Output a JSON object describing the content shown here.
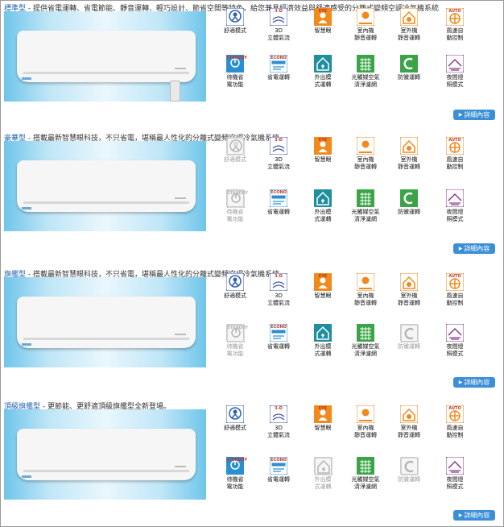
{
  "sections": [
    {
      "series": "標準型",
      "description": " - 提供省電運轉、省電節能、靜音運轉、輕巧設計、節省空間等特色，給您兼具經濟效益與舒適感受的分離式變頻空調冷氣機系統",
      "more_label": "詳細內容",
      "features": [
        {
          "label": "舒適模式",
          "icon": "comfort-icon",
          "enabled": true
        },
        {
          "label": "3D\n立體氣流",
          "icon": "3d-airflow-icon",
          "enabled": true
        },
        {
          "label": "智慧眼",
          "icon": "intelligent-eye-icon",
          "enabled": true
        },
        {
          "label": "室內機\n靜音運轉",
          "icon": "indoor-quiet-icon",
          "enabled": true
        },
        {
          "label": "室外機\n靜音運轉",
          "icon": "outdoor-quiet-icon",
          "enabled": true
        },
        {
          "label": "風速自\n動控制",
          "icon": "auto-fan-icon",
          "enabled": true
        },
        {
          "label": "待機省\n電功能",
          "icon": "standby-icon",
          "enabled": true
        },
        {
          "label": "省電運轉",
          "icon": "econo-icon",
          "enabled": true
        },
        {
          "label": "外出模\n式運轉",
          "icon": "away-mode-icon",
          "enabled": true
        },
        {
          "label": "光觸媒空氣\n清淨濾網",
          "icon": "photocatalytic-filter-icon",
          "enabled": true
        },
        {
          "label": "防黴運轉",
          "icon": "anti-mold-icon",
          "enabled": true
        },
        {
          "label": "夜間燈\n照模式",
          "icon": "night-mode-icon",
          "enabled": true
        }
      ]
    },
    {
      "series": "豪華型",
      "description": " - 搭載最新智慧眼科技，不只省電，堪稱最人性化的分離式變頻空調冷氣機系統",
      "more_label": "詳細內容",
      "features": [
        {
          "label": "舒適模式",
          "icon": "comfort-icon",
          "enabled": false
        },
        {
          "label": "3D\n立體氣流",
          "icon": "3d-airflow-icon",
          "enabled": true
        },
        {
          "label": "智慧眼",
          "icon": "intelligent-eye-icon",
          "enabled": true
        },
        {
          "label": "室內機\n靜音運轉",
          "icon": "indoor-quiet-icon",
          "enabled": true
        },
        {
          "label": "室外機\n靜音運轉",
          "icon": "outdoor-quiet-icon",
          "enabled": true
        },
        {
          "label": "風速自\n動控制",
          "icon": "auto-fan-icon",
          "enabled": true
        },
        {
          "label": "待機省\n電功能",
          "icon": "standby-icon",
          "enabled": false
        },
        {
          "label": "省電運轉",
          "icon": "econo-icon",
          "enabled": true
        },
        {
          "label": "外出模\n式運轉",
          "icon": "away-mode-icon",
          "enabled": true
        },
        {
          "label": "光觸媒空氣\n清淨濾網",
          "icon": "photocatalytic-filter-icon",
          "enabled": true
        },
        {
          "label": "防黴運轉",
          "icon": "anti-mold-icon",
          "enabled": true
        },
        {
          "label": "夜間燈\n照模式",
          "icon": "night-mode-icon",
          "enabled": true
        }
      ]
    },
    {
      "series": "旗艦型",
      "description": " - 搭載最新智慧眼科技，不只省電，堪稱最人性化的分離式變頻空調冷氣機系統",
      "more_label": "詳細內容",
      "features": [
        {
          "label": "舒適模式",
          "icon": "comfort-icon",
          "enabled": true
        },
        {
          "label": "3D\n立體氣流",
          "icon": "3d-airflow-icon",
          "enabled": true
        },
        {
          "label": "智慧眼",
          "icon": "intelligent-eye-icon",
          "enabled": true
        },
        {
          "label": "室內機\n靜音運轉",
          "icon": "indoor-quiet-icon",
          "enabled": true
        },
        {
          "label": "室外機\n靜音運轉",
          "icon": "outdoor-quiet-icon",
          "enabled": true
        },
        {
          "label": "風速自\n動控制",
          "icon": "auto-fan-icon",
          "enabled": true
        },
        {
          "label": "待機省\n電功能",
          "icon": "standby-icon",
          "enabled": false
        },
        {
          "label": "省電運轉",
          "icon": "econo-icon",
          "enabled": true
        },
        {
          "label": "外出模\n式運轉",
          "icon": "away-mode-icon",
          "enabled": true
        },
        {
          "label": "光觸媒空氣\n清淨濾網",
          "icon": "photocatalytic-filter-icon",
          "enabled": true
        },
        {
          "label": "防黴運轉",
          "icon": "anti-mold-icon",
          "enabled": false
        },
        {
          "label": "夜間燈\n照模式",
          "icon": "night-mode-icon",
          "enabled": true
        }
      ]
    },
    {
      "series": "頂級旗艦型",
      "description": " - 更節能、更舒適頂級旗艦型全新登場。",
      "more_label": "詳細內容",
      "features": [
        {
          "label": "舒適模式",
          "icon": "comfort-icon",
          "enabled": true
        },
        {
          "label": "3D\n立體氣流",
          "icon": "3d-airflow-icon",
          "enabled": true
        },
        {
          "label": "智慧眼",
          "icon": "intelligent-eye-icon",
          "enabled": true
        },
        {
          "label": "室內機\n靜音運轉",
          "icon": "indoor-quiet-icon",
          "enabled": true
        },
        {
          "label": "室外機\n靜音運轉",
          "icon": "outdoor-quiet-icon",
          "enabled": true
        },
        {
          "label": "風速自\n動控制",
          "icon": "auto-fan-icon",
          "enabled": true
        },
        {
          "label": "待機省\n電功能",
          "icon": "standby-icon",
          "enabled": true
        },
        {
          "label": "省電運轉",
          "icon": "econo-icon",
          "enabled": true
        },
        {
          "label": "外出模\n式運轉",
          "icon": "away-mode-icon",
          "enabled": false
        },
        {
          "label": "光觸媒空氣\n清淨濾網",
          "icon": "photocatalytic-filter-icon",
          "enabled": true
        },
        {
          "label": "防黴運轉",
          "icon": "anti-mold-icon",
          "enabled": false
        },
        {
          "label": "夜間燈\n照模式",
          "icon": "night-mode-icon",
          "enabled": true
        }
      ]
    }
  ],
  "icon_badges": {
    "3d-airflow-icon": "3-D",
    "intelligent-eye-icon": "EYE",
    "auto-fan-icon": "AUTO",
    "standby-icon": "STANDBY",
    "econo-icon": "ECONO"
  },
  "colors": {
    "series_link": "#1f5fb0",
    "more_button": "#3b8fd7",
    "comfort": "#2f5db5",
    "airflow": "#3e54a6",
    "eye": "#f08a1c",
    "quiet": "#f08a1c",
    "auto": "#f08a1c",
    "standby": "#2a8fd0",
    "econo": "#2a8fd0",
    "away": "#1f8f9e",
    "filter": "#3aa447",
    "antimold": "#3aa447",
    "night": "#8a3a8c",
    "disabled": "#b5b5b5"
  }
}
